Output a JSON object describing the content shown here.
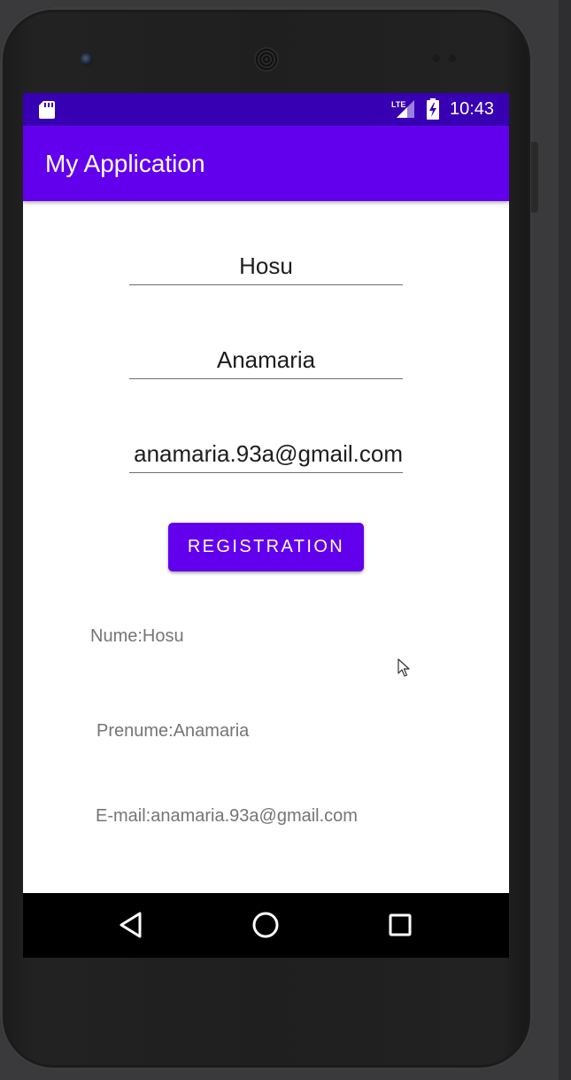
{
  "status_bar": {
    "time": "10:43",
    "network_label": "LTE",
    "icons": [
      "sd-card-icon",
      "lte-signal-icon",
      "battery-charging-icon"
    ]
  },
  "app_bar": {
    "title": "My Application"
  },
  "form": {
    "last_name_value": "Hosu",
    "first_name_value": "Anamaria",
    "email_value": "anamaria.93a@gmail.com",
    "register_label": "REGISTRATION"
  },
  "output": {
    "last_name_line": "Nume:Hosu",
    "first_name_line": "Prenume:Anamaria",
    "email_line": "E-mail:anamaria.93a@gmail.com"
  },
  "nav_bar": {
    "icons": [
      "back-icon",
      "home-icon",
      "recents-icon"
    ]
  },
  "colors": {
    "primary": "#6200ee",
    "primary_dark": "#3700b3",
    "output_text": "#757575",
    "input_text": "#1d1d1d"
  }
}
